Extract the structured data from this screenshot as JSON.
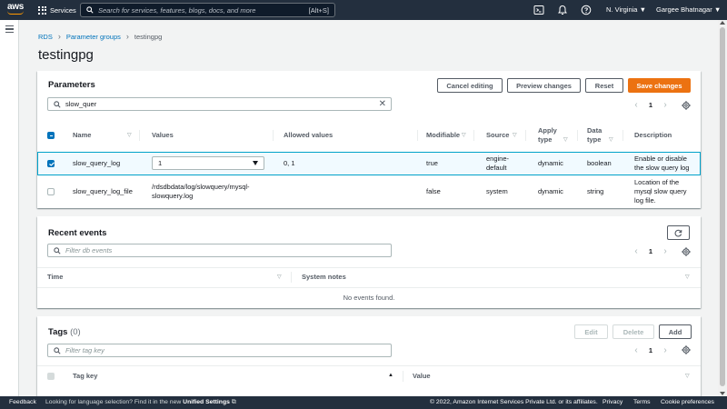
{
  "topnav": {
    "logo": "aws",
    "services_label": "Services",
    "search_placeholder": "Search for services, features, blogs, docs, and more",
    "search_shortcut": "[Alt+S]",
    "icons": [
      "cloudshell-icon",
      "bell-icon",
      "help-icon"
    ],
    "region_label": "N. Virginia",
    "user_label": "Gargee Bhatnagar"
  },
  "breadcrumb": {
    "items": [
      "RDS",
      "Parameter groups"
    ],
    "current": "testingpg"
  },
  "page_title": "testingpg",
  "parameters": {
    "title": "Parameters",
    "buttons": {
      "cancel": "Cancel editing",
      "preview": "Preview changes",
      "reset": "Reset",
      "save": "Save changes"
    },
    "filter_value": "slow_quer",
    "page": "1",
    "columns": {
      "name": "Name",
      "values": "Values",
      "allowed": "Allowed values",
      "modifiable": "Modifiable",
      "source": "Source",
      "apply_type_1": "Apply",
      "apply_type_2": "type",
      "data_type_1": "Data",
      "data_type_2": "type",
      "description": "Description"
    },
    "rows": [
      {
        "name": "slow_query_log",
        "value": "1",
        "allowed": "0, 1",
        "modifiable": "true",
        "source_1": "engine-",
        "source_2": "default",
        "apply_type": "dynamic",
        "data_type": "boolean",
        "desc_1": "Enable or disable",
        "desc_2": "the slow query log",
        "desc_3": ""
      },
      {
        "name": "slow_query_log_file",
        "value_1": "/rdsdbdata/log/slowquery/mysql-",
        "value_2": "slowquery.log",
        "allowed": "",
        "modifiable": "false",
        "source": "system",
        "apply_type": "dynamic",
        "data_type": "string",
        "desc_1": "Location of the",
        "desc_2": "mysql slow query",
        "desc_3": "log file."
      }
    ]
  },
  "recent_events": {
    "title": "Recent events",
    "filter_placeholder": "Filter db events",
    "page": "1",
    "columns": {
      "time": "Time",
      "notes": "System notes"
    },
    "empty": "No events found."
  },
  "tags": {
    "title": "Tags",
    "count": "(0)",
    "buttons": {
      "edit": "Edit",
      "delete": "Delete",
      "add": "Add"
    },
    "filter_placeholder": "Filter tag key",
    "page": "1",
    "columns": {
      "key": "Tag key",
      "value": "Value"
    }
  },
  "footer": {
    "feedback": "Feedback",
    "lang_prefix": "Looking for language selection? Find it in the new",
    "lang_link": "Unified Settings",
    "copyright": "© 2022, Amazon Internet Services Private Ltd. or its affiliates.",
    "privacy": "Privacy",
    "terms": "Terms",
    "cookies": "Cookie preferences"
  },
  "colors": {
    "nav_bg": "#232f3e",
    "accent_orange": "#ec7211",
    "link_blue": "#0073bb",
    "selected_row": "#f1faff"
  }
}
